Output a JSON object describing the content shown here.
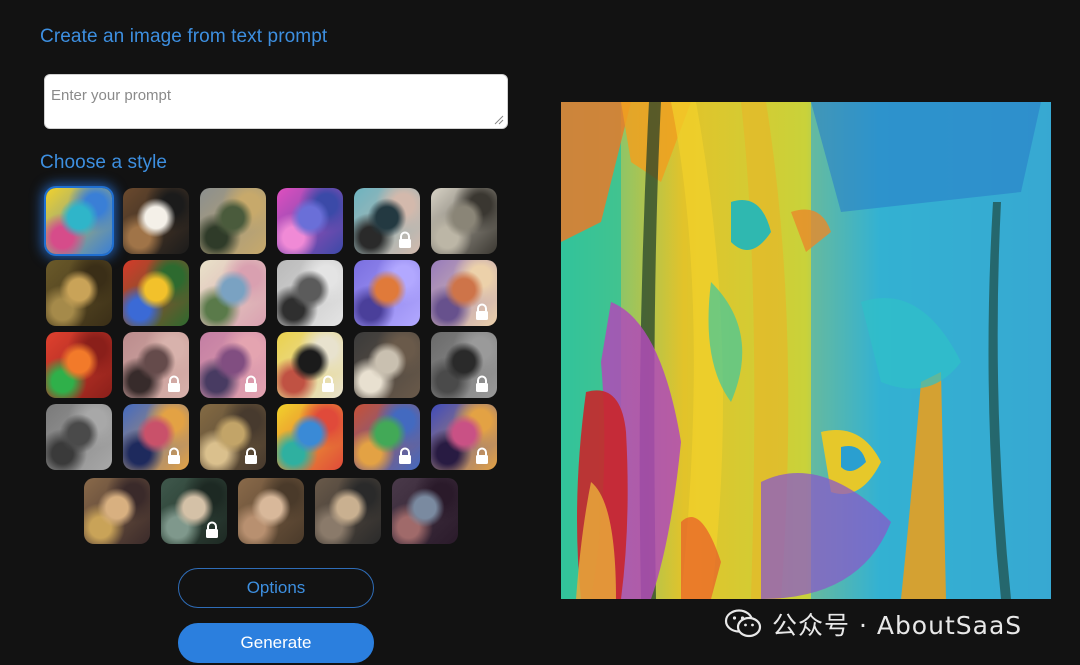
{
  "header": {
    "title": "Create an image from text prompt"
  },
  "prompt": {
    "placeholder": "Enter your prompt",
    "value": ""
  },
  "styles": {
    "title": "Choose a style",
    "selected_index": 0,
    "items": [
      {
        "name": "abstract-paint",
        "locked": false,
        "colors": [
          "#f2d22b",
          "#2fb5c9",
          "#3a7fd6",
          "#d64c8a"
        ]
      },
      {
        "name": "panda",
        "locked": false,
        "colors": [
          "#6b4a2e",
          "#f4f0e8",
          "#1b1b1b",
          "#a07448"
        ]
      },
      {
        "name": "landscape",
        "locked": false,
        "colors": [
          "#8b8f8e",
          "#4a5b3c",
          "#c7a96b",
          "#2f3b29"
        ]
      },
      {
        "name": "robot",
        "locked": false,
        "colors": [
          "#e04fbf",
          "#6a6fd8",
          "#3b4aa8",
          "#f08ad6"
        ]
      },
      {
        "name": "woman-portrait",
        "locked": true,
        "colors": [
          "#5fb7c7",
          "#1e3a44",
          "#d8b8a8",
          "#2a2a2a"
        ]
      },
      {
        "name": "vintage-sketch",
        "locked": false,
        "colors": [
          "#d8d3c6",
          "#8a8577",
          "#3a3731",
          "#bcb6a6"
        ]
      },
      {
        "name": "mona-lisa",
        "locked": false,
        "colors": [
          "#6b5a2a",
          "#c9a358",
          "#3a2e17",
          "#a58a4a"
        ]
      },
      {
        "name": "flower-vase",
        "locked": false,
        "colors": [
          "#d63a2a",
          "#f2c12b",
          "#2d6a2f",
          "#3b6ad6"
        ]
      },
      {
        "name": "ballet-dancers",
        "locked": false,
        "colors": [
          "#e9e2c9",
          "#7aa2c2",
          "#d9a0b0",
          "#5a7a4a"
        ]
      },
      {
        "name": "metal-object",
        "locked": false,
        "colors": [
          "#b9b9b9",
          "#5b5b5b",
          "#e4e4e4",
          "#2f2f2f"
        ]
      },
      {
        "name": "isometric-room",
        "locked": false,
        "colors": [
          "#7a6fe0",
          "#e07a3a",
          "#b2a8ff",
          "#4a3f9a"
        ]
      },
      {
        "name": "fox-character",
        "locked": true,
        "colors": [
          "#9c79c9",
          "#e0703a",
          "#f2d0a0",
          "#6a4f9a"
        ]
      },
      {
        "name": "neon-face",
        "locked": false,
        "colors": [
          "#e0412f",
          "#f27a2a",
          "#8a1f1a",
          "#2fb04a"
        ]
      },
      {
        "name": "pastel-face",
        "locked": true,
        "colors": [
          "#c48a8a",
          "#6a4a4a",
          "#e0b0a8",
          "#3a2a2a"
        ]
      },
      {
        "name": "pink-cloud",
        "locked": true,
        "colors": [
          "#d07aa8",
          "#8a4a8a",
          "#f0a0b0",
          "#4a3a6a"
        ]
      },
      {
        "name": "pop-art",
        "locked": true,
        "colors": [
          "#f2d22b",
          "#1b1b1b",
          "#e9e2c9",
          "#d64c3a"
        ]
      },
      {
        "name": "modern-house",
        "locked": false,
        "colors": [
          "#3a3a3a",
          "#c9c0b0",
          "#6a5a4a",
          "#e8e0d0"
        ]
      },
      {
        "name": "dark-sculpture",
        "locked": true,
        "colors": [
          "#6a6a6a",
          "#2a2a2a",
          "#9a9a9a",
          "#4a4a4a"
        ]
      },
      {
        "name": "grey-texture",
        "locked": false,
        "colors": [
          "#7a7a7a",
          "#4a4a4a",
          "#a8a8a8",
          "#3a3a3a"
        ]
      },
      {
        "name": "blue-rabbit",
        "locked": true,
        "colors": [
          "#3a6ad6",
          "#e04a6a",
          "#f2a02b",
          "#1b2a6a"
        ]
      },
      {
        "name": "golden-blur",
        "locked": true,
        "colors": [
          "#8a6a3a",
          "#c9a358",
          "#4a3a2a",
          "#e0c080"
        ]
      },
      {
        "name": "icon-grid",
        "locked": false,
        "colors": [
          "#f2d22b",
          "#3a8ad6",
          "#e04a3a",
          "#2fb0a0"
        ]
      },
      {
        "name": "red-swirl",
        "locked": true,
        "colors": [
          "#e04a2a",
          "#2fb04a",
          "#3a6ad6",
          "#f2a02b"
        ]
      },
      {
        "name": "colorful-creature",
        "locked": true,
        "colors": [
          "#3a4ad6",
          "#e04a8a",
          "#f2a02b",
          "#2a1a4a"
        ]
      },
      {
        "name": "golden-warrior",
        "locked": false,
        "colors": [
          "#8a6a4a",
          "#d8b080",
          "#3a2a2a",
          "#c9a358"
        ]
      },
      {
        "name": "teal-portrait",
        "locked": true,
        "colors": [
          "#3a5a4a",
          "#d8c0a0",
          "#1b2a22",
          "#7a9a8a"
        ]
      },
      {
        "name": "renaissance-lady",
        "locked": false,
        "colors": [
          "#8a6a4a",
          "#d8b89a",
          "#4a3a2a",
          "#b89070"
        ]
      },
      {
        "name": "musketeer",
        "locked": false,
        "colors": [
          "#6a5a4a",
          "#c9b090",
          "#2a2a2a",
          "#8a7a6a"
        ]
      },
      {
        "name": "dark-hero",
        "locked": false,
        "colors": [
          "#4a3a4a",
          "#7a8aa0",
          "#2a1a2a",
          "#a06a6a"
        ]
      }
    ]
  },
  "buttons": {
    "options_label": "Options",
    "generate_label": "Generate"
  },
  "watermark": {
    "text": "公众号 · AboutSaaS"
  },
  "colors": {
    "accent": "#3d8fe0",
    "generate_bg": "#2b7fde",
    "background": "#121212"
  }
}
